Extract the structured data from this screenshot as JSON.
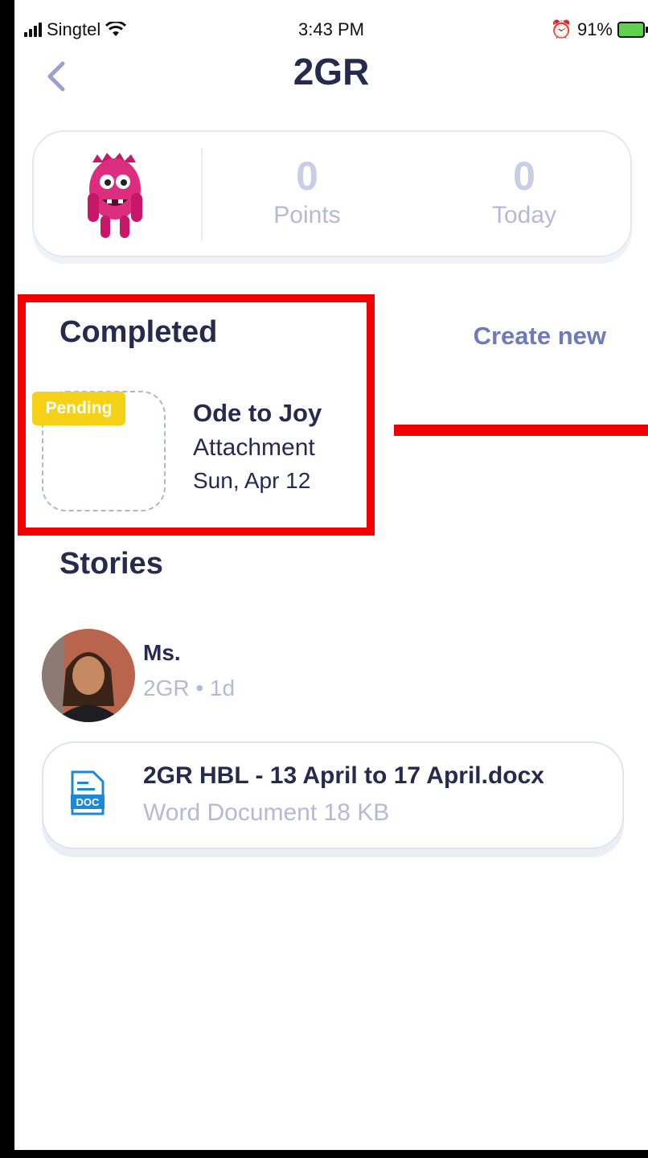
{
  "status_bar": {
    "carrier": "Singtel",
    "time": "3:43 PM",
    "battery": "91%"
  },
  "header": {
    "back_icon": "chevron-left-icon",
    "title": "2GR"
  },
  "stats": {
    "points": {
      "value": "0",
      "label": "Points"
    },
    "today": {
      "value": "0",
      "label": "Today"
    }
  },
  "completed": {
    "heading": "Completed",
    "create_label": "Create new",
    "item": {
      "badge": "Pending",
      "title": "Ode to Joy",
      "type": "Attachment",
      "date": "Sun, Apr 12"
    }
  },
  "stories": {
    "heading": "Stories",
    "post": {
      "author": "Ms.",
      "meta": "2GR • 1d",
      "attachment": {
        "icon_label": "DOC",
        "file_name": "2GR HBL - 13 April to 17 April.docx",
        "file_info": "Word Document 18 KB"
      }
    }
  },
  "colors": {
    "accent": "#6e7ab9",
    "heading": "#272a4f",
    "muted": "#b5b9d6",
    "pending": "#f5d118",
    "annotation": "#f20000"
  }
}
